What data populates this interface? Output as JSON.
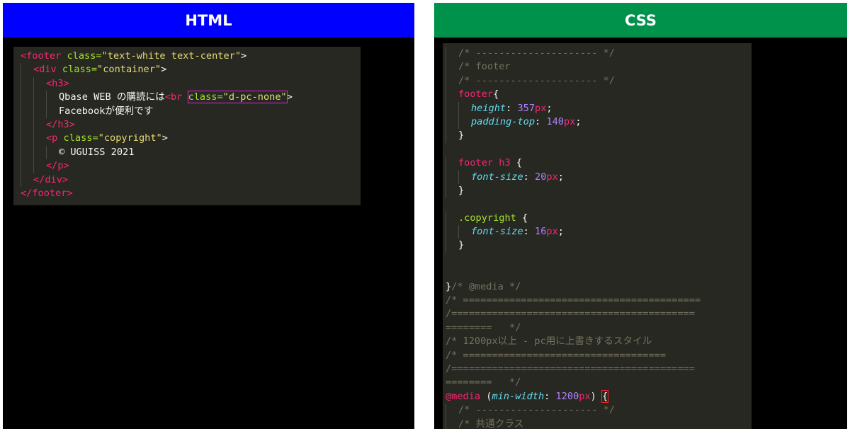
{
  "panels": {
    "html": {
      "title": "HTML",
      "color": "#0000ff"
    },
    "css": {
      "title": "CSS",
      "color": "#00914a"
    }
  },
  "html_code": {
    "l1_tag_open": "<footer",
    "l1_attr": " class=",
    "l1_val": "\"text-white text-center\"",
    "l1_close": ">",
    "l2_tag": "<div",
    "l2_attr": " class=",
    "l2_val": "\"container\"",
    "l2_close": ">",
    "l3_tag": "<h3>",
    "l4_text": "Qbase WEB の購読には",
    "l4_br": "<br",
    "l4_hl_attr": "class=",
    "l4_hl_val": "\"d-pc-none\"",
    "l4_close": ">",
    "l5_text": "Facebookが便利です",
    "l6_tag": "</h3>",
    "l7_tag": "<p",
    "l7_attr": " class=",
    "l7_val": "\"copyright\"",
    "l7_close": ">",
    "l8_text": "© UGUISS 2021",
    "l9_tag": "</p>",
    "l10_tag": "</div>",
    "l11_tag": "</footer>"
  },
  "css_code": {
    "c1": "/* --------------------- */",
    "c2": "/* footer",
    "c3": "/* --------------------- */",
    "sel_footer": "footer",
    "brace_open": "{",
    "p_height": "height",
    "v_height": "357",
    "p_padding": "padding-top",
    "v_padding": "140",
    "unit_px": "px",
    "brace_close": "}",
    "sel_footer_h3": "footer h3",
    "p_font": "font-size",
    "v_font20": "20",
    "sel_copyright": ".copyright",
    "v_font16": "16",
    "end_brace": "}",
    "c_media": "/* @media */",
    "c_eq1": "/* =========================================",
    "c_eq2": "/==========================================",
    "c_eq3": "========   */",
    "c_1200": "/* 1200px以上 - pc用に上書きするスタイル",
    "c_eq4": "/* ===================================",
    "c_eq5": "/==========================================",
    "c_eq6": "========   */",
    "at_media": "@media",
    "media_prop": "min-width",
    "media_val": "1200",
    "c_last1": "/* --------------------- */",
    "c_last2": "/* 共通クラス"
  }
}
